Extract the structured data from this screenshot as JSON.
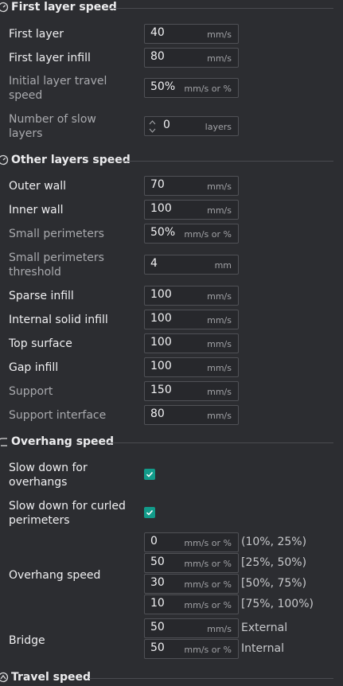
{
  "sections": {
    "first_layer": "First layer speed",
    "other_layers": "Other layers speed",
    "overhang": "Overhang speed",
    "travel": "Travel speed"
  },
  "first_layer": {
    "first_layer": {
      "label": "First layer",
      "value": "40",
      "unit": "mm/s"
    },
    "first_layer_infill": {
      "label": "First layer infill",
      "value": "80",
      "unit": "mm/s"
    },
    "initial_travel": {
      "label_1": "Initial layer travel",
      "label_2": "speed",
      "value": "50%",
      "unit": "mm/s or %"
    },
    "slow_layers": {
      "label_1": "Number of slow",
      "label_2": "layers",
      "value": "0",
      "unit": "layers"
    }
  },
  "other_layers": {
    "outer_wall": {
      "label": "Outer wall",
      "value": "70",
      "unit": "mm/s"
    },
    "inner_wall": {
      "label": "Inner wall",
      "value": "100",
      "unit": "mm/s"
    },
    "small_perimeters": {
      "label": "Small perimeters",
      "value": "50%",
      "unit": "mm/s or %"
    },
    "small_perimeters_threshold": {
      "label_1": "Small perimeters",
      "label_2": "threshold",
      "value": "4",
      "unit": "mm"
    },
    "sparse_infill": {
      "label": "Sparse infill",
      "value": "100",
      "unit": "mm/s"
    },
    "internal_solid_infill": {
      "label": "Internal solid infill",
      "value": "100",
      "unit": "mm/s"
    },
    "top_surface": {
      "label": "Top surface",
      "value": "100",
      "unit": "mm/s"
    },
    "gap_infill": {
      "label": "Gap infill",
      "value": "100",
      "unit": "mm/s"
    },
    "support": {
      "label": "Support",
      "value": "150",
      "unit": "mm/s"
    },
    "support_interface": {
      "label": "Support interface",
      "value": "80",
      "unit": "mm/s"
    }
  },
  "overhang": {
    "slow_overhangs": {
      "label_1": "Slow down for",
      "label_2": "overhangs",
      "checked": true
    },
    "slow_curled": {
      "label_1": "Slow down for curled",
      "label_2": "perimeters",
      "checked": true
    },
    "overhang_speed_label": "Overhang speed",
    "overhang_rows": [
      {
        "value": "0",
        "unit": "mm/s or %",
        "range": "(10%, 25%)"
      },
      {
        "value": "50",
        "unit": "mm/s or %",
        "range": "[25%, 50%)"
      },
      {
        "value": "30",
        "unit": "mm/s or %",
        "range": "[50%, 75%)"
      },
      {
        "value": "10",
        "unit": "mm/s or %",
        "range": "[75%, 100%)"
      }
    ],
    "bridge_label": "Bridge",
    "bridge_rows": [
      {
        "value": "50",
        "unit": "mm/s",
        "kind": "External"
      },
      {
        "value": "50",
        "unit": "mm/s or %",
        "kind": "Internal"
      }
    ]
  },
  "colors": {
    "accent": "#129b8a",
    "background": "#2c2d31",
    "field_border": "#505156"
  }
}
